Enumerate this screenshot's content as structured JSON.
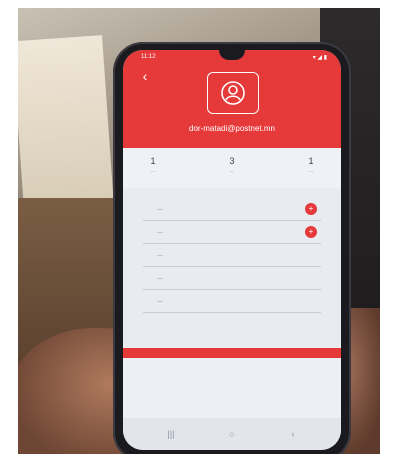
{
  "statusbar": {
    "time": "11:12",
    "icons": "▾ ◢ ▮"
  },
  "header": {
    "email": "dor-matadi@postnet.mn"
  },
  "stats": [
    {
      "num": "1",
      "label": "..."
    },
    {
      "num": "3",
      "label": "..."
    },
    {
      "num": "1",
      "label": "..."
    }
  ],
  "list": {
    "rows": [
      {
        "text": "…"
      },
      {
        "text": "…"
      },
      {
        "text": "…"
      },
      {
        "text": "…"
      },
      {
        "text": "…"
      }
    ]
  },
  "icons": {
    "back": "chevron-left-icon",
    "avatar": "user-avatar-icon",
    "row_action": "add-circle-icon",
    "nav_recent": "recent-apps-icon",
    "nav_home": "home-icon",
    "nav_back": "back-nav-icon"
  },
  "colors": {
    "accent": "#e63a3a",
    "screen_bg": "#e8ecf1"
  }
}
